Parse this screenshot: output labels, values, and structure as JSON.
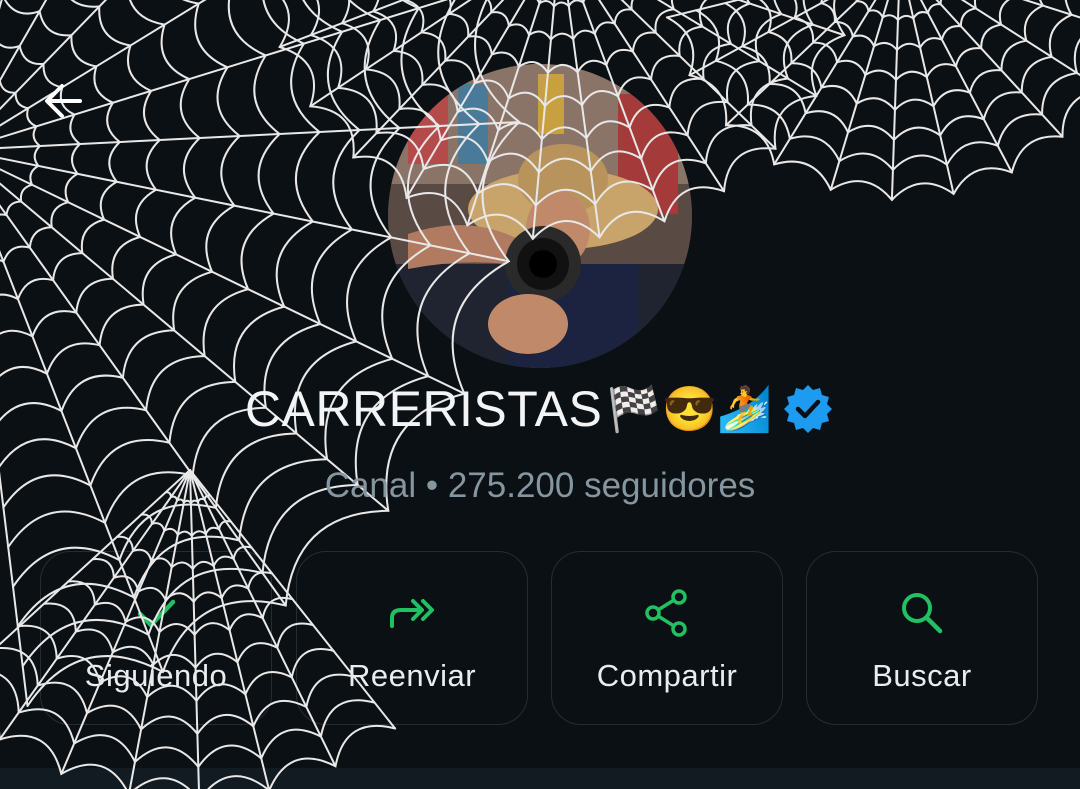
{
  "channel": {
    "name": "CARRERISTAS",
    "emojis": "🏁😎🏄",
    "subtitle": "Canal • 275.200 seguidores"
  },
  "actions": [
    {
      "label": "Siguiendo",
      "icon": "check-icon"
    },
    {
      "label": "Reenviar",
      "icon": "forward-icon"
    },
    {
      "label": "Compartir",
      "icon": "share-icon"
    },
    {
      "label": "Buscar",
      "icon": "search-icon"
    }
  ],
  "colors": {
    "background": "#0b1014",
    "accent": "#21c063",
    "verified": "#1d9bf0",
    "subtitle": "#8696a0"
  }
}
